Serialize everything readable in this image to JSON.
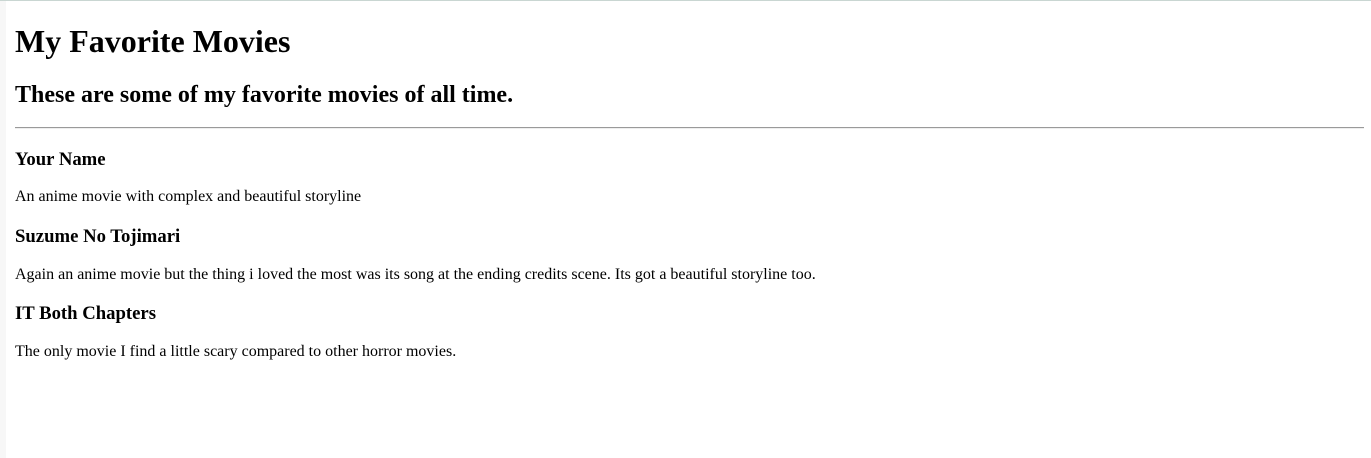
{
  "header": {
    "title": "My Favorite Movies",
    "subtitle": "These are some of my favorite movies of all time."
  },
  "movies": [
    {
      "title": "Your Name",
      "description": "An anime movie with complex and beautiful storyline"
    },
    {
      "title": "Suzume No Tojimari",
      "description": "Again an anime movie but the thing i loved the most was its song at the ending credits scene. Its got a beautiful storyline too."
    },
    {
      "title": "IT Both Chapters",
      "description": "The only movie I find a little scary compared to other horror movies."
    }
  ]
}
